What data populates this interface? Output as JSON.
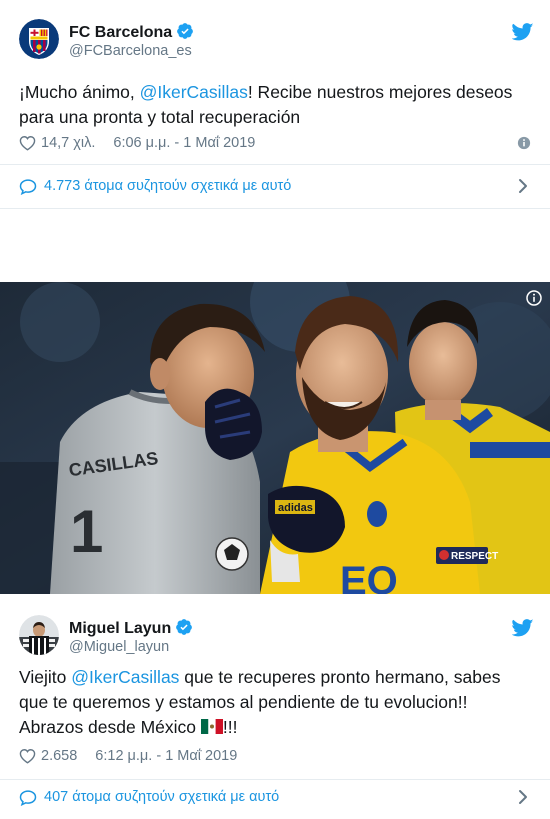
{
  "tweet1": {
    "author_name": "FC Barcelona",
    "handle": "@FCBarcelona_es",
    "text_before": "¡Mucho ánimo, ",
    "mention": "@IkerCasillas",
    "text_after": "! Recibe nuestros mejores deseos para una pronta y total recuperación",
    "likes": "14,7 χιλ.",
    "timestamp": "6:06 μ.μ. - 1 Μαΐ 2019",
    "conversation": "4.773 άτομα συζητούν σχετικά με αυτό"
  },
  "photo": {
    "jersey_text": "CASILLAS",
    "jersey_number": "1",
    "badge_text": "RESPECT",
    "glove_brand": "adidas",
    "shirt_text": "EO"
  },
  "tweet2": {
    "author_name": "Miguel Layun",
    "handle": "@Miguel_layun",
    "text_before": "Viejito ",
    "mention": "@IkerCasillas",
    "text_after": " que te recuperes pronto hermano, sabes que te queremos y estamos al pendiente de tu evolucion!! Abrazos desde México ",
    "text_end": "!!!",
    "likes": "2.658",
    "timestamp": "6:12 μ.μ. - 1 Μαΐ 2019",
    "conversation": "407 άτομα συζητούν σχετικά με αυτό"
  },
  "colors": {
    "link": "#1b95e0",
    "secondary": "#657786",
    "barca_blue": "#004d98",
    "barca_red": "#a50044",
    "porto_yellow": "#f2c810"
  },
  "icons": [
    "verified-icon",
    "twitter-bird-icon",
    "heart-icon",
    "info-icon",
    "reply-bubble-icon",
    "chevron-right-icon",
    "mexico-flag-icon"
  ]
}
